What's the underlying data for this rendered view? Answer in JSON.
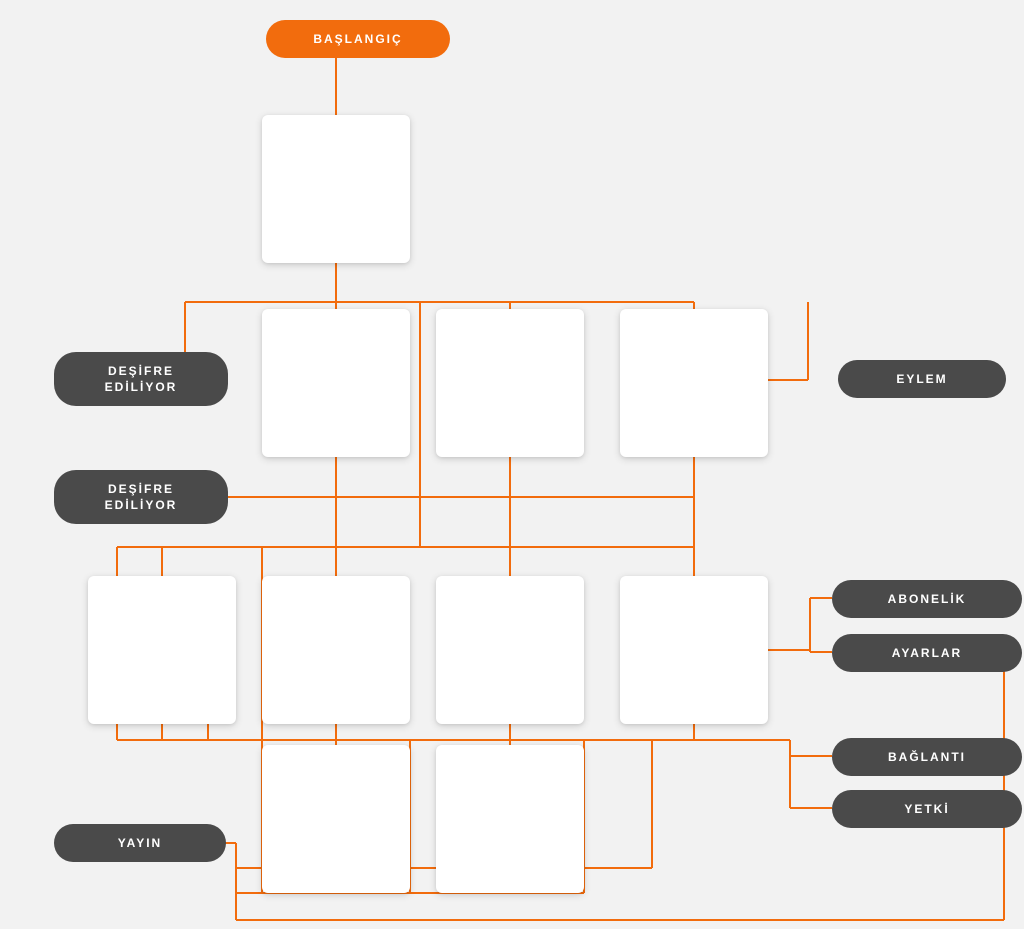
{
  "labels": {
    "start": "BAŞLANGIÇ",
    "decrypt1": "DEŞİFRE\nEDİLİYOR",
    "decrypt2": "DEŞİFRE\nEDİLİYOR",
    "action": "EYLEM",
    "subscription": "ABONELİK",
    "settings": "AYARLAR",
    "connection": "BAĞLANTI",
    "authority": "YETKİ",
    "broadcast": "YAYIN"
  },
  "colors": {
    "accent": "#f26c0d",
    "dark": "#4a4a4a",
    "bg": "#f2f2f2",
    "card": "#ffffff"
  }
}
